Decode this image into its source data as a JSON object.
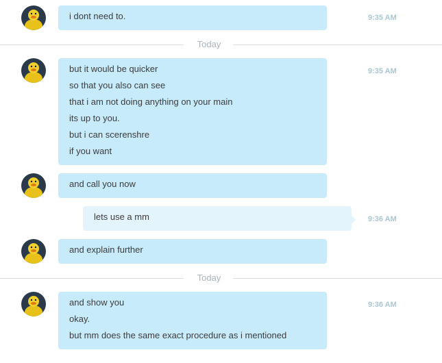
{
  "messages": [
    {
      "lines": [
        "i dont need to."
      ],
      "time": "9:35 AM"
    },
    {
      "lines": [
        "but it would be quicker",
        "so that you also can see",
        "that i am not doing anything on your main",
        "its up to you.",
        "but i can scerenshre",
        "if you want"
      ],
      "time": "9:35 AM"
    },
    {
      "lines": [
        "and call you now"
      ]
    },
    {
      "lines": [
        "lets use a mm"
      ],
      "time": "9:36 AM"
    },
    {
      "lines": [
        "and explain further"
      ]
    },
    {
      "lines": [
        "and show you",
        "okay.",
        "but mm does the same exact procedure as i mentioned"
      ],
      "time": "9:36 AM"
    }
  ],
  "dividers": [
    "Today",
    "Today"
  ],
  "colors": {
    "incoming_bubble": "#c7ebfb",
    "outgoing_bubble": "#e4f4fc",
    "timestamp": "#a9c7d4",
    "divider_text": "#aab4bb"
  },
  "avatar_icon": "yellow-duck-avatar-icon"
}
